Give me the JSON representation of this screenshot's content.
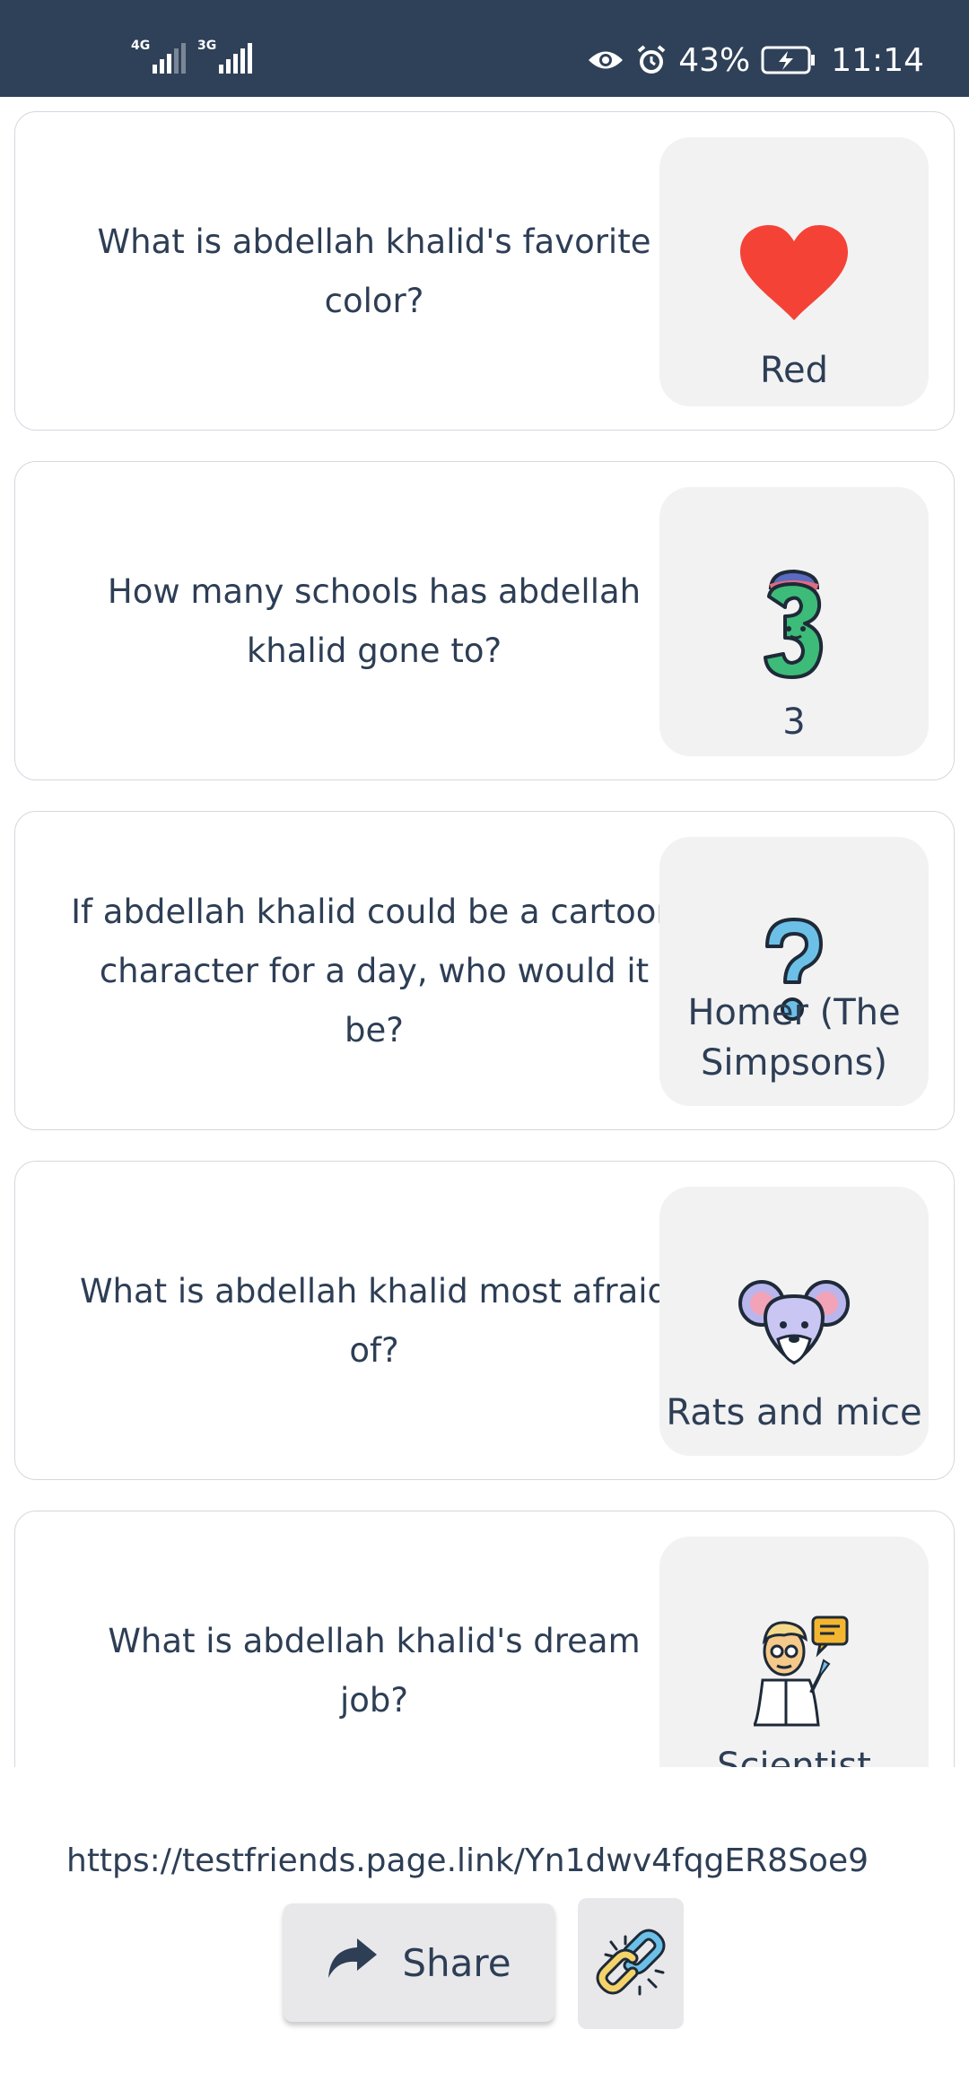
{
  "status_bar": {
    "network_1": "4G",
    "network_2": "3G",
    "battery": "43%",
    "time": "11:14",
    "icons": [
      "eye-icon",
      "alarm-icon",
      "battery-icon"
    ]
  },
  "cards": [
    {
      "question": "What is abdellah khalid's favorite color?",
      "answer": "Red",
      "icon": "heart-icon"
    },
    {
      "question": "How many schools has abdellah khalid gone to?",
      "answer": "3",
      "icon": "number-three-icon"
    },
    {
      "question": "If abdellah khalid could be a cartoon character for a day, who would it be?",
      "answer": "Homer (The Simpsons)",
      "icon": "question-mark-icon"
    },
    {
      "question": "What is abdellah khalid most afraid of?",
      "answer": "Rats and mice",
      "icon": "mouse-icon"
    },
    {
      "question": "What is abdellah khalid's dream job?",
      "answer": "Scientist",
      "icon": "scientist-icon"
    }
  ],
  "footer": {
    "url": "https://testfriends.page.link/Yn1dwv4fqgER8Soe9",
    "share_label": "Share"
  },
  "colors": {
    "status_bar": "#2f4159",
    "text": "#2d3e55",
    "answer_bg": "#f2f2f3",
    "heart": "#f44336",
    "button_bg": "#e8e8ea"
  }
}
